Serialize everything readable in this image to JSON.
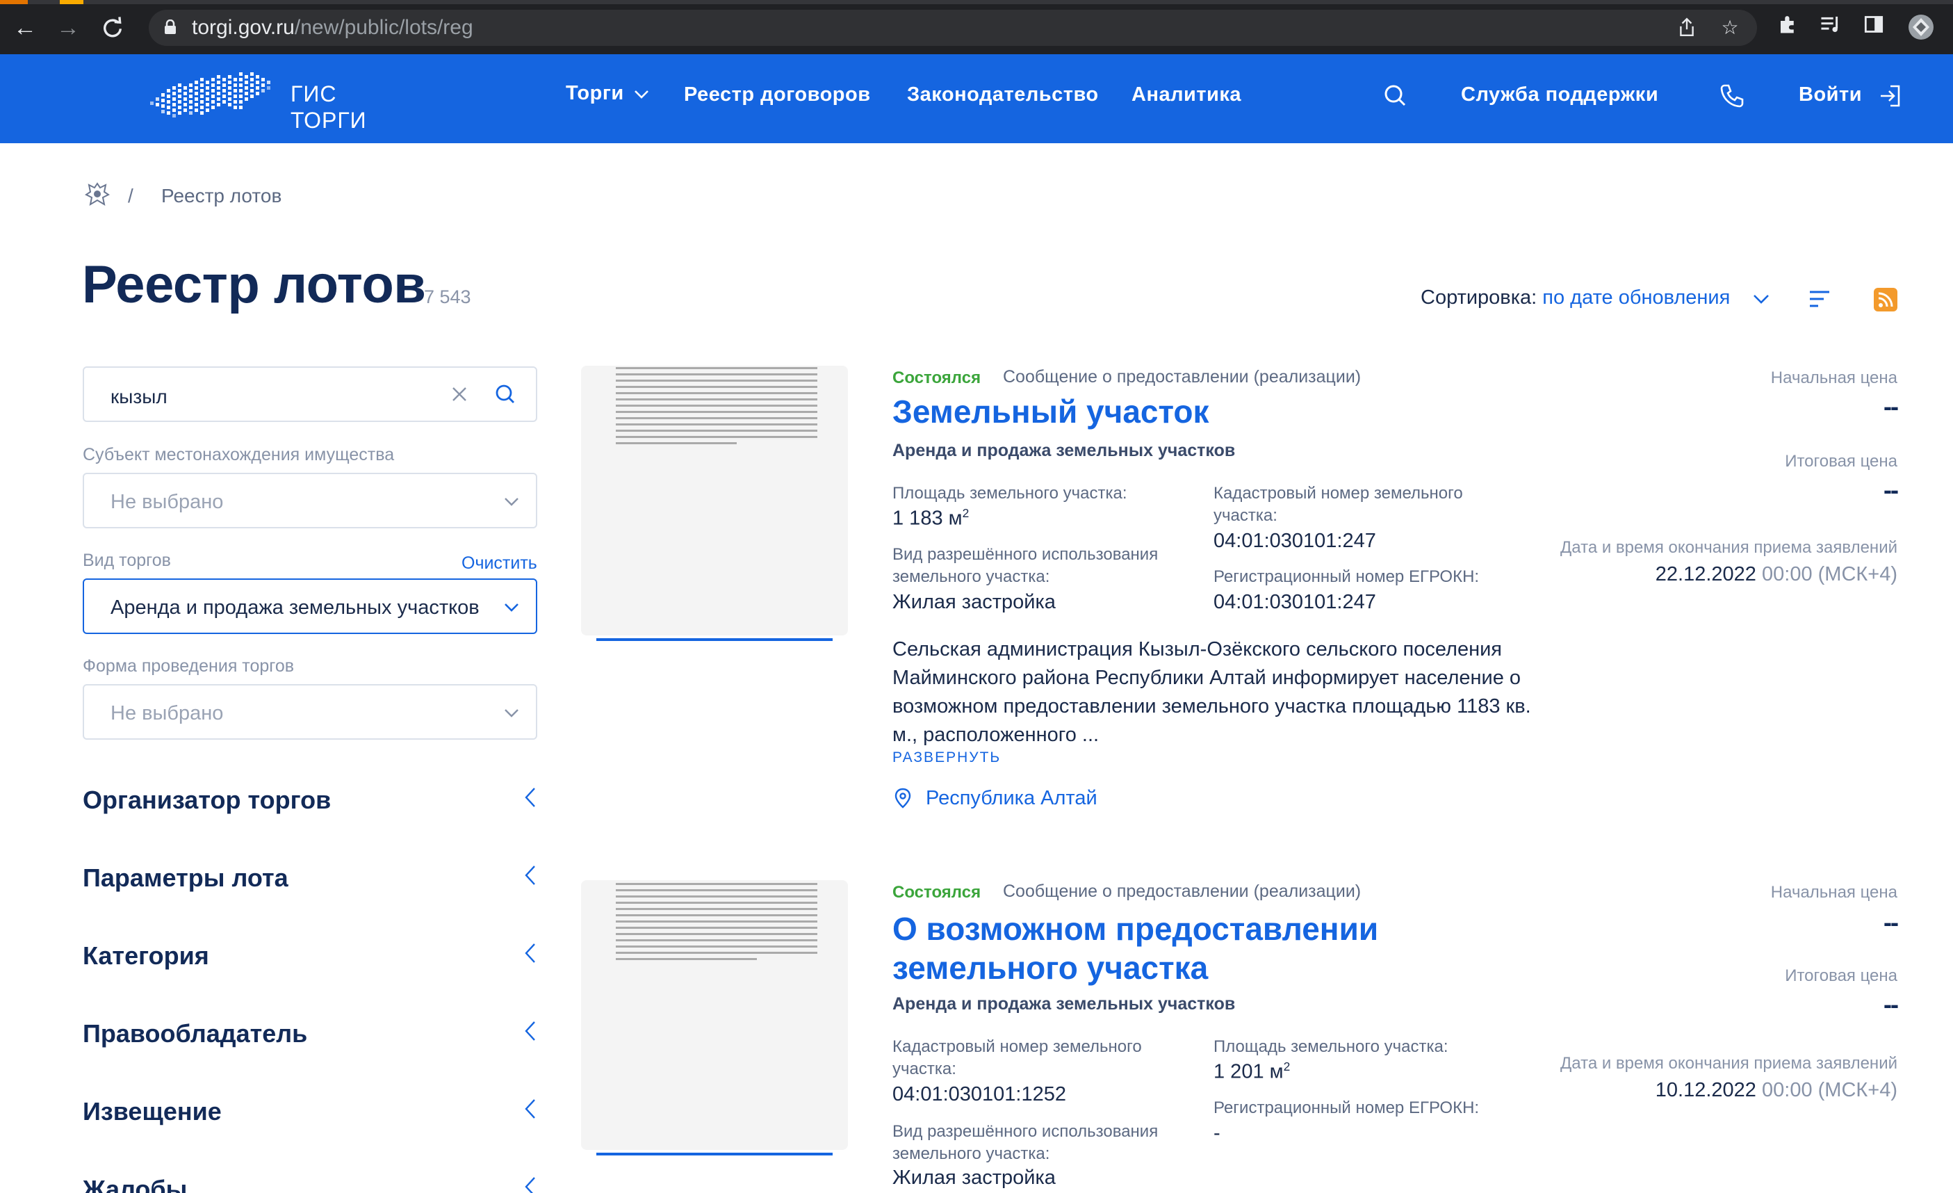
{
  "browser": {
    "url_host": "torgi.gov.ru",
    "url_path": "/new/public/lots/reg"
  },
  "header": {
    "logo_line1": "ГИС",
    "logo_line2": "ТОРГИ",
    "nav": [
      "Торги",
      "Реестр договоров",
      "Законодательство",
      "Аналитика"
    ],
    "support": "Служба поддержки",
    "login": "Войти"
  },
  "breadcrumb": {
    "separator": "/",
    "current": "Реестр лотов"
  },
  "page": {
    "title": "Реестр лотов",
    "count": "7 543"
  },
  "sort": {
    "label": "Сортировка:",
    "value": "по дате обновления"
  },
  "filters": {
    "search_value": "кызыл",
    "subject_label": "Субъект местонахождения имущества",
    "subject_value": "Не выбрано",
    "auction_type_label": "Вид торгов",
    "clear_label": "Очистить",
    "auction_type_value": "Аренда и продажа земельных участков",
    "form_label": "Форма проведения торгов",
    "form_value": "Не выбрано",
    "sections": [
      "Организатор торгов",
      "Параметры лота",
      "Категория",
      "Правообладатель",
      "Извещение",
      "Жалобы"
    ]
  },
  "lots": [
    {
      "status": "Состоялся",
      "notice": "Сообщение о предоставлении (реализации)",
      "title": "Земельный участок",
      "subtitle": "Аренда и продажа земельных участков",
      "area_label": "Площадь земельного участка:",
      "area_value": "1 183 м",
      "area_unit_sup": "2",
      "cadastral_label": "Кадастровый номер земельного участка:",
      "cadastral_value": "04:01:030101:247",
      "use_label": "Вид разрешённого использования земельного участка:",
      "use_value": "Жилая застройка",
      "reg_label": "Регистрационный номер ЕГРОКН:",
      "reg_value": "04:01:030101:247",
      "description": "Сельская администрация Кызыл-Озёкского сельского поселения Майминского района Республики Алтай информирует население о возможном предоставлении земельного участка площадью 1183 кв. м., расположенного ...",
      "expand": "РАЗВЕРНУТЬ",
      "region": "Республика Алтай",
      "start_price_label": "Начальная цена",
      "start_price": "--",
      "final_price_label": "Итоговая цена",
      "final_price": "--",
      "deadline_label": "Дата и время окончания приема заявлений",
      "deadline_date": "22.12.2022",
      "deadline_time": "00:00 (МСК+4)"
    },
    {
      "status": "Состоялся",
      "notice": "Сообщение о предоставлении (реализации)",
      "title_line1": "О возможном предоставлении",
      "title_line2": "земельного участка",
      "subtitle": "Аренда и продажа земельных участков",
      "cadastral_label": "Кадастровый номер земельного участка:",
      "cadastral_value": "04:01:030101:1252",
      "area_label": "Площадь земельного участка:",
      "area_value": "1 201 м",
      "area_unit_sup": "2",
      "reg_label": "Регистрационный номер ЕГРОКН:",
      "reg_value": "-",
      "use_label": "Вид разрешённого использования земельного участка:",
      "use_value": "Жилая застройка",
      "start_price_label": "Начальная цена",
      "start_price": "--",
      "final_price_label": "Итоговая цена",
      "final_price": "--",
      "deadline_label": "Дата и время окончания приема заявлений",
      "deadline_date": "10.12.2022",
      "deadline_time": "00:00 (МСК+4)"
    }
  ]
}
